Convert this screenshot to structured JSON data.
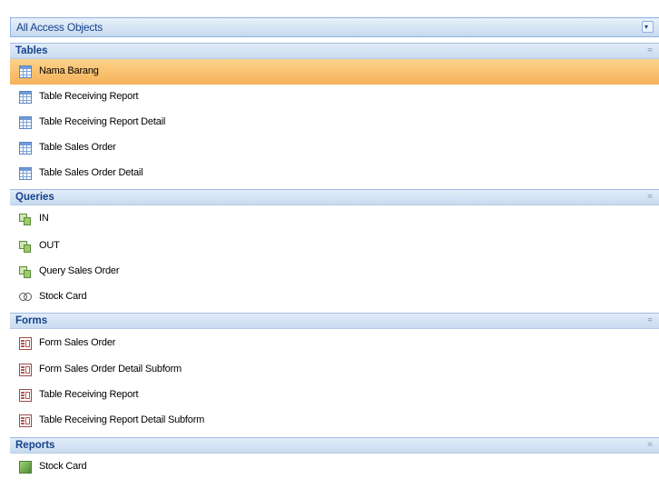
{
  "nav_pane": {
    "title": "All Access Objects",
    "menu_glyph": "▾"
  },
  "groups": [
    {
      "title": "Tables",
      "collapse_glyph": "≈",
      "items": [
        {
          "label": "Nama Barang",
          "icon": "table-icon",
          "selected": true
        },
        {
          "label": "Table Receiving Report",
          "icon": "table-icon"
        },
        {
          "label": "Table Receiving Report Detail",
          "icon": "table-icon"
        },
        {
          "label": "Table Sales Order",
          "icon": "table-icon"
        },
        {
          "label": "Table Sales Order Detail",
          "icon": "table-icon"
        }
      ]
    },
    {
      "title": "Queries",
      "collapse_glyph": "≈",
      "items": [
        {
          "label": "IN",
          "icon": "query-icon"
        },
        {
          "label": "OUT",
          "icon": "query-icon"
        },
        {
          "label": "Query Sales Order",
          "icon": "query-icon"
        },
        {
          "label": "Stock Card",
          "icon": "union-query-icon"
        }
      ]
    },
    {
      "title": "Forms",
      "collapse_glyph": "≈",
      "items": [
        {
          "label": "Form Sales Order",
          "icon": "form-icon"
        },
        {
          "label": "Form Sales Order Detail Subform",
          "icon": "form-icon"
        },
        {
          "label": "Table Receiving Report",
          "icon": "form-icon"
        },
        {
          "label": "Table Receiving Report Detail Subform",
          "icon": "form-icon"
        }
      ]
    },
    {
      "title": "Reports",
      "collapse_glyph": "≈",
      "items": [
        {
          "label": "Stock Card",
          "icon": "report-icon"
        }
      ]
    }
  ],
  "colors": {
    "selected_row": "#f6b25a",
    "header_text": "#15428b",
    "group_header_bg": "#c9dbf0",
    "border": "#8db2e3"
  }
}
